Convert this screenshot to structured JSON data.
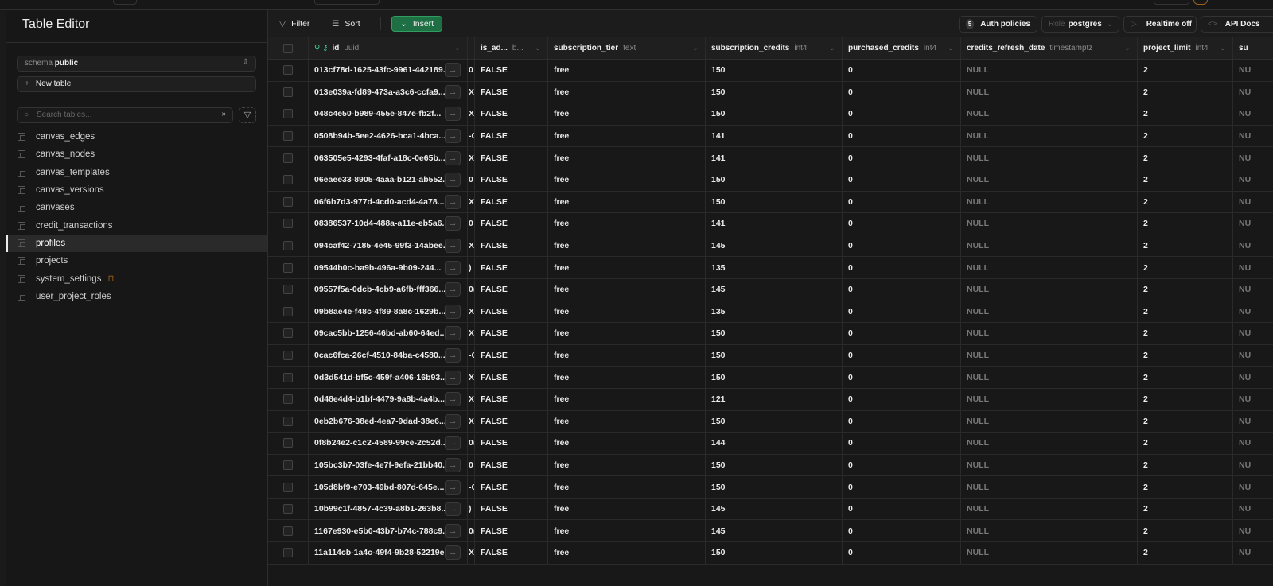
{
  "sidebar": {
    "title": "Table Editor",
    "schema_label": "schema",
    "schema_value": "public",
    "new_table": "New table",
    "search_placeholder": "Search tables...",
    "tables": [
      {
        "name": "canvas_edges"
      },
      {
        "name": "canvas_nodes"
      },
      {
        "name": "canvas_templates"
      },
      {
        "name": "canvas_versions"
      },
      {
        "name": "canvases"
      },
      {
        "name": "credit_transactions"
      },
      {
        "name": "profiles",
        "active": true
      },
      {
        "name": "projects"
      },
      {
        "name": "system_settings",
        "locked": true
      },
      {
        "name": "user_project_roles"
      }
    ]
  },
  "toolbar": {
    "filter": "Filter",
    "sort": "Sort",
    "insert": "Insert",
    "auth_count": "5",
    "auth_policies": "Auth policies",
    "role_label": "Role",
    "role_value": "postgres",
    "realtime": "Realtime off",
    "api_docs": "API Docs"
  },
  "columns": [
    {
      "name": "id",
      "type": "uuid"
    },
    {
      "name": "",
      "type": ""
    },
    {
      "name": "is_ad...",
      "type": "b..."
    },
    {
      "name": "subscription_tier",
      "type": "text"
    },
    {
      "name": "subscription_credits",
      "type": "int4"
    },
    {
      "name": "purchased_credits",
      "type": "int4"
    },
    {
      "name": "credits_refresh_date",
      "type": "timestamptz"
    },
    {
      "name": "project_limit",
      "type": "int4"
    },
    {
      "name": "su",
      "type": ""
    }
  ],
  "colors": {
    "accent": "#3ecf8e",
    "insert_bg": "#1f6f44",
    "lock": "#a0601a"
  },
  "rows": [
    [
      "013cf78d-1625-43fc-9961-442189...",
      "0",
      "FALSE",
      "free",
      "150",
      "0",
      "NULL",
      "2",
      "NU"
    ],
    [
      "013e039a-fd89-473a-a3c6-ccfa9...",
      "X",
      "FALSE",
      "free",
      "150",
      "0",
      "NULL",
      "2",
      "NU"
    ],
    [
      "048c4e50-b989-455e-847e-fb2f...",
      "X",
      "FALSE",
      "free",
      "150",
      "0",
      "NULL",
      "2",
      "NU"
    ],
    [
      "0508b94b-5ee2-4626-bca1-4bca...",
      "-C",
      "FALSE",
      "free",
      "141",
      "0",
      "NULL",
      "2",
      "NU"
    ],
    [
      "063505e5-4293-4faf-a18c-0e65b...",
      "X",
      "FALSE",
      "free",
      "141",
      "0",
      "NULL",
      "2",
      "NU"
    ],
    [
      "06eaee33-8905-4aaa-b121-ab552...",
      "0",
      "FALSE",
      "free",
      "150",
      "0",
      "NULL",
      "2",
      "NU"
    ],
    [
      "06f6b7d3-977d-4cd0-acd4-4a78...",
      "X",
      "FALSE",
      "free",
      "150",
      "0",
      "NULL",
      "2",
      "NU"
    ],
    [
      "08386537-10d4-488a-a11e-eb5a6...",
      "0",
      "FALSE",
      "free",
      "141",
      "0",
      "NULL",
      "2",
      "NU"
    ],
    [
      "094caf42-7185-4e45-99f3-14abee...",
      "X",
      "FALSE",
      "free",
      "145",
      "0",
      "NULL",
      "2",
      "NU"
    ],
    [
      "09544b0c-ba9b-496a-9b09-244...",
      ")",
      "FALSE",
      "free",
      "135",
      "0",
      "NULL",
      "2",
      "NU"
    ],
    [
      "09557f5a-0dcb-4cb9-a6fb-fff366...",
      "0(",
      "FALSE",
      "free",
      "145",
      "0",
      "NULL",
      "2",
      "NU"
    ],
    [
      "09b8ae4e-f48c-4f89-8a8c-1629b...",
      "X",
      "FALSE",
      "free",
      "135",
      "0",
      "NULL",
      "2",
      "NU"
    ],
    [
      "09cac5bb-1256-46bd-ab60-64ed...",
      "X",
      "FALSE",
      "free",
      "150",
      "0",
      "NULL",
      "2",
      "NU"
    ],
    [
      "0cac6fca-26cf-4510-84ba-c4580...",
      "-C",
      "FALSE",
      "free",
      "150",
      "0",
      "NULL",
      "2",
      "NU"
    ],
    [
      "0d3d541d-bf5c-459f-a406-16b93...",
      "X",
      "FALSE",
      "free",
      "150",
      "0",
      "NULL",
      "2",
      "NU"
    ],
    [
      "0d48e4d4-b1bf-4479-9a8b-4a4b...",
      "X",
      "FALSE",
      "free",
      "121",
      "0",
      "NULL",
      "2",
      "NU"
    ],
    [
      "0eb2b676-38ed-4ea7-9dad-38e6...",
      "X",
      "FALSE",
      "free",
      "150",
      "0",
      "NULL",
      "2",
      "NU"
    ],
    [
      "0f8b24e2-c1c2-4589-99ce-2c52d...",
      "0(",
      "FALSE",
      "free",
      "144",
      "0",
      "NULL",
      "2",
      "NU"
    ],
    [
      "105bc3b7-03fe-4e7f-9efa-21bb40...",
      "0",
      "FALSE",
      "free",
      "150",
      "0",
      "NULL",
      "2",
      "NU"
    ],
    [
      "105d8bf9-e703-49bd-807d-645e...",
      "-C",
      "FALSE",
      "free",
      "150",
      "0",
      "NULL",
      "2",
      "NU"
    ],
    [
      "10b99c1f-4857-4c39-a8b1-263b8...",
      ")",
      "FALSE",
      "free",
      "145",
      "0",
      "NULL",
      "2",
      "NU"
    ],
    [
      "1167e930-e5b0-43b7-b74c-788c9...",
      "0(",
      "FALSE",
      "free",
      "145",
      "0",
      "NULL",
      "2",
      "NU"
    ],
    [
      "11a114cb-1a4c-49f4-9b28-52219ec...",
      "X",
      "FALSE",
      "free",
      "150",
      "0",
      "NULL",
      "2",
      "NU"
    ]
  ]
}
